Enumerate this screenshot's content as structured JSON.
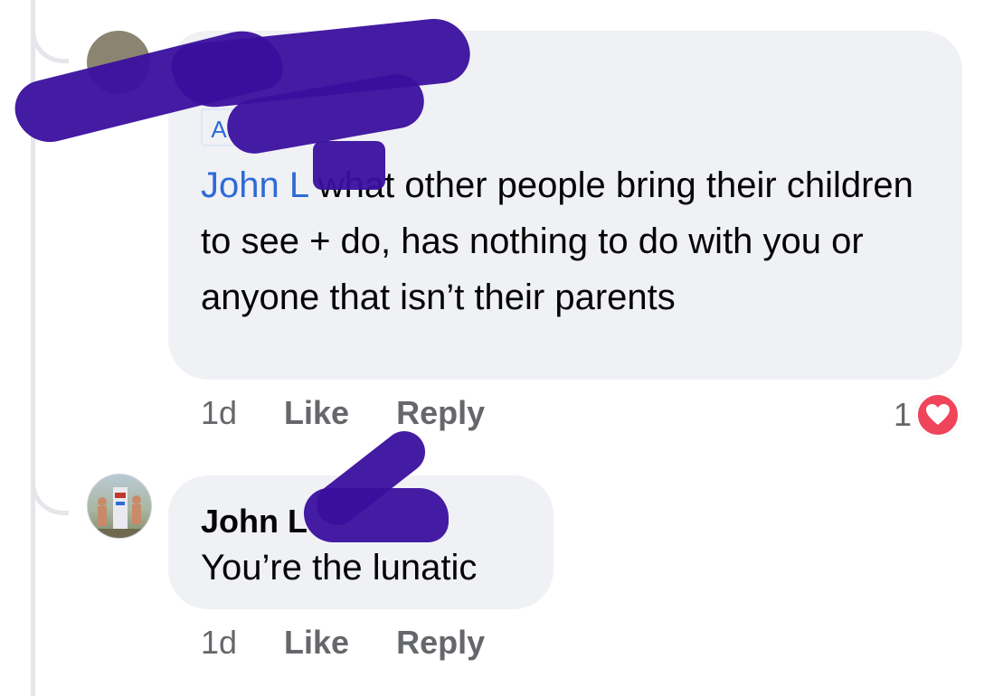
{
  "comment_1": {
    "author_tag": "A",
    "mention": "John L",
    "text": " what other people bring their children to see + do, has nothing to do with you or anyone that isn’t their parents",
    "time": "1d",
    "like_label": "Like",
    "reply_label": "Reply",
    "reaction_count": "1",
    "reaction_icon": "heart-icon"
  },
  "comment_2": {
    "author": "John L",
    "text": "You’re the lunatic",
    "time": "1d",
    "like_label": "Like",
    "reply_label": "Reply"
  },
  "colors": {
    "bubble": "#f0f1f5",
    "mention": "#2e6bd6",
    "meta_text": "#65676b",
    "heart": "#f0445b",
    "redaction": "#3a0f9e"
  }
}
